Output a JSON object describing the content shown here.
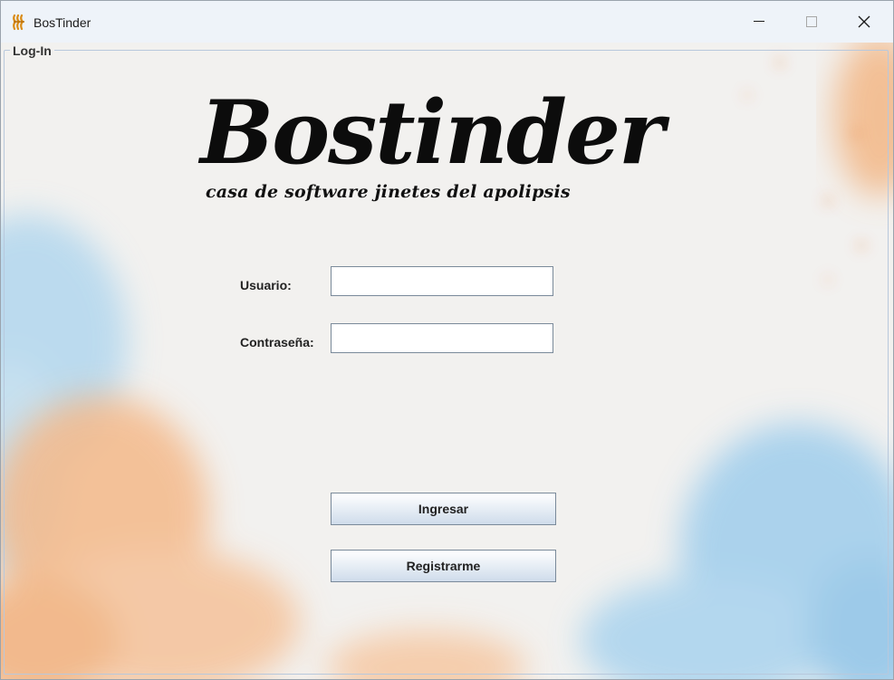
{
  "window": {
    "title": "BosTinder",
    "icon": "bostinder-app-icon",
    "controls": [
      "minimize-icon",
      "maximize-icon",
      "close-icon"
    ]
  },
  "panel": {
    "title": "Log-In"
  },
  "logo": {
    "brand": "Bostinder",
    "tagline": "casa de software jinetes del apolipsis"
  },
  "form": {
    "user_label": "Usuario:",
    "user_value": "",
    "password_label": "Contraseña:",
    "password_value": ""
  },
  "actions": {
    "login_label": "Ingresar",
    "register_label": "Registrarme"
  },
  "colors": {
    "watercolor_orange": "#f4b98a",
    "watercolor_blue": "#a9d3ee",
    "paper": "#f2f1ef",
    "titlebar": "#eef3f9"
  }
}
